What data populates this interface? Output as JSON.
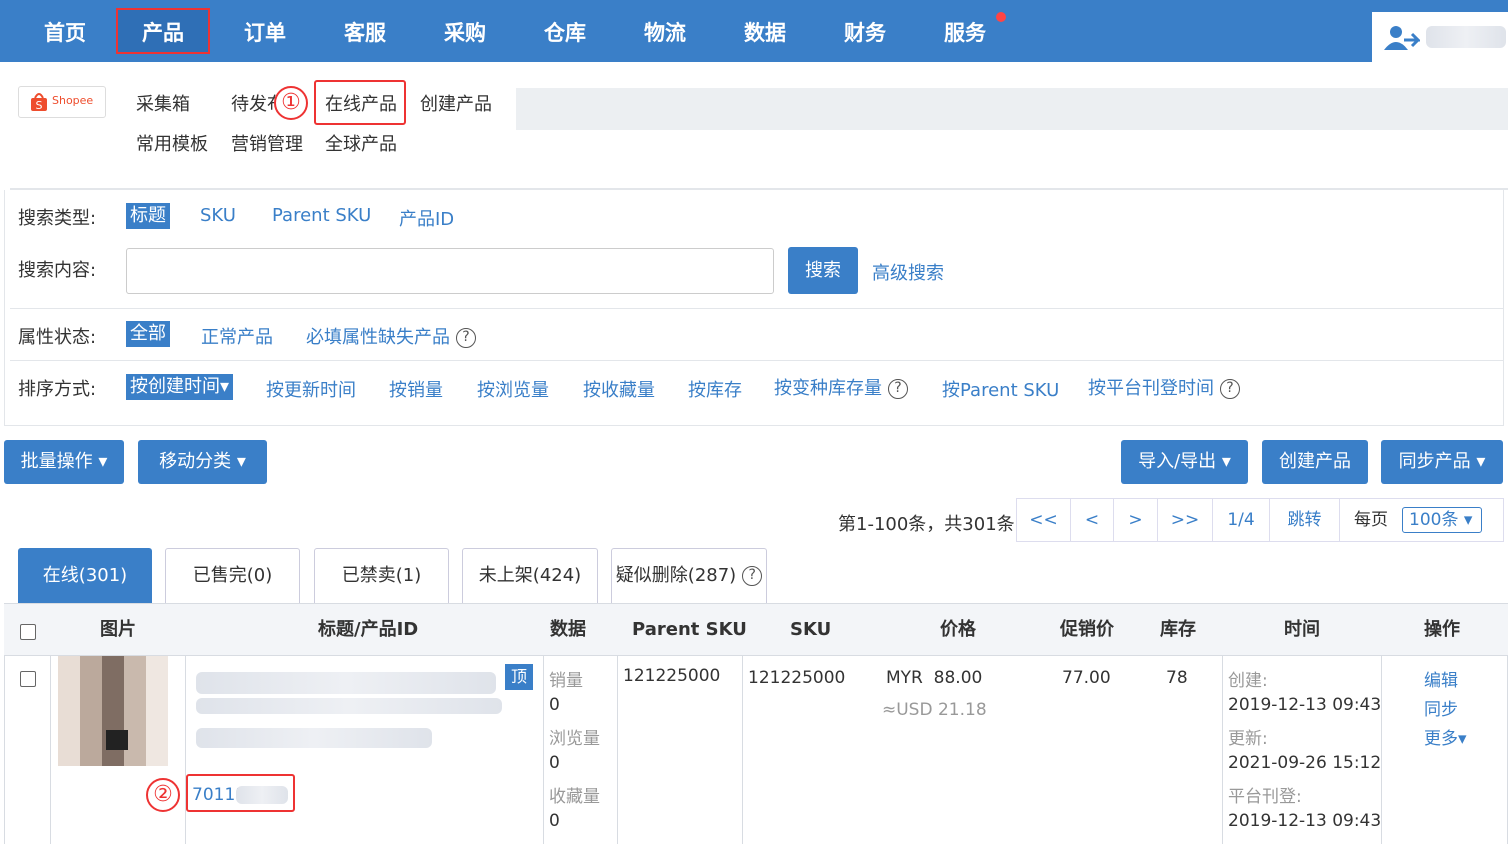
{
  "nav": {
    "items": [
      "首页",
      "产品",
      "订单",
      "客服",
      "采购",
      "仓库",
      "物流",
      "数据",
      "财务",
      "服务"
    ]
  },
  "store_logo": "Shopee",
  "subnav": {
    "items": [
      "采集箱",
      "待发布",
      "在线产品",
      "创建产品",
      "常用模板",
      "营销管理",
      "全球产品"
    ]
  },
  "annotations": {
    "one": "①",
    "two": "②"
  },
  "search": {
    "type_label": "搜索类型:",
    "types": [
      "标题",
      "SKU",
      "Parent SKU",
      "产品ID"
    ],
    "content_label": "搜索内容:",
    "input_value": "",
    "search_btn": "搜索",
    "advanced": "高级搜索"
  },
  "attr": {
    "label": "属性状态:",
    "options": [
      "全部",
      "正常产品",
      "必填属性缺失产品"
    ]
  },
  "sort": {
    "label": "排序方式:",
    "options": [
      "按创建时间▾",
      "按更新时间",
      "按销量",
      "按浏览量",
      "按收藏量",
      "按库存",
      "按变种库存量",
      "按Parent SKU",
      "按平台刊登时间"
    ]
  },
  "toolbar": {
    "batch": "批量操作 ▾",
    "move": "移动分类 ▾",
    "import_export": "导入/导出 ▾",
    "create": "创建产品",
    "sync": "同步产品 ▾"
  },
  "pagination": {
    "summary": "第1-100条，共301条",
    "first": "<<",
    "prev": "<",
    "next": ">",
    "last": ">>",
    "page": "1/4",
    "jump": "跳转",
    "per_page_label": "每页",
    "per_page": "100条 ▾"
  },
  "tabs": [
    "在线(301)",
    "已售完(0)",
    "已禁卖(1)",
    "未上架(424)",
    "疑似删除(287)"
  ],
  "table": {
    "headers": [
      "图片",
      "标题/产品ID",
      "数据",
      "Parent SKU",
      "SKU",
      "价格",
      "促销价",
      "库存",
      "时间",
      "操作"
    ],
    "row": {
      "top_badge": "顶",
      "product_id": "70111",
      "sales_label": "销量",
      "sales": "0",
      "views_label": "浏览量",
      "views": "0",
      "fav_label": "收藏量",
      "fav": "0",
      "parent_sku": "121225000",
      "sku": "121225000",
      "price": "MYR  88.00",
      "price_usd": "≈USD 21.18",
      "promo": "77.00",
      "stock": "78",
      "created_label": "创建:",
      "created": "2019-12-13 09:43",
      "updated_label": "更新:",
      "updated": "2021-09-26 15:12",
      "listed_label": "平台刊登:",
      "listed": "2019-12-13 09:43",
      "actions": [
        "编辑",
        "同步",
        "更多▾"
      ]
    }
  },
  "colors": {
    "primary": "#3a7fc8",
    "annotation": "#e33"
  }
}
